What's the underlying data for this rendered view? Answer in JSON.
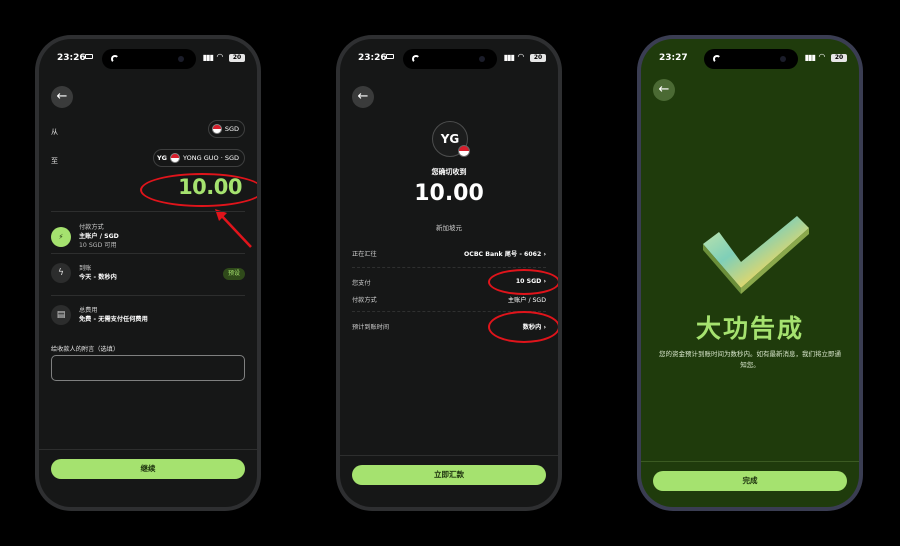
{
  "status": {
    "time1": "23:26",
    "time2": "23:26",
    "time3": "23:27",
    "battery": "20"
  },
  "screen1": {
    "from_label": "从",
    "to_label": "至",
    "from_currency": "SGD",
    "to_initials": "YG",
    "to_recipient": "YONG GUO · SGD",
    "amount": "10.00",
    "payment_method_title": "付款方式",
    "payment_method_main": "主账户 / SGD",
    "payment_method_sub": "10 SGD 可用",
    "arrival_title": "到账",
    "arrival_main": "今天 - 数秒内",
    "arrival_chip": "预设",
    "fee_title": "总费用",
    "fee_main": "免费 - 无需支付任何费用",
    "note_label": "给收款人的附言（选填）",
    "note_value": "",
    "continue_button": "继续"
  },
  "screen2": {
    "avatar_initials": "YG",
    "receive_label": "您确切收到",
    "amount": "10.00",
    "currency_name": "新加坡元",
    "to_label": "正在汇往",
    "to_value": "OCBC Bank 尾号 - 6062",
    "pay_label": "您支付",
    "pay_value": "10 SGD",
    "method_label": "付款方式",
    "method_value": "主账户 / SGD",
    "eta_label": "预计到账时间",
    "eta_value": "数秒内",
    "send_button": "立即汇款"
  },
  "screen3": {
    "title": "大功告成",
    "message": "您的资金预计到账时间为数秒内。如有最新消息，我们将立即通知您。",
    "done_button": "完成"
  },
  "colors": {
    "accent": "#a5e26f",
    "annotation": "#e0141b",
    "success_bg": "#1f3b0c"
  }
}
